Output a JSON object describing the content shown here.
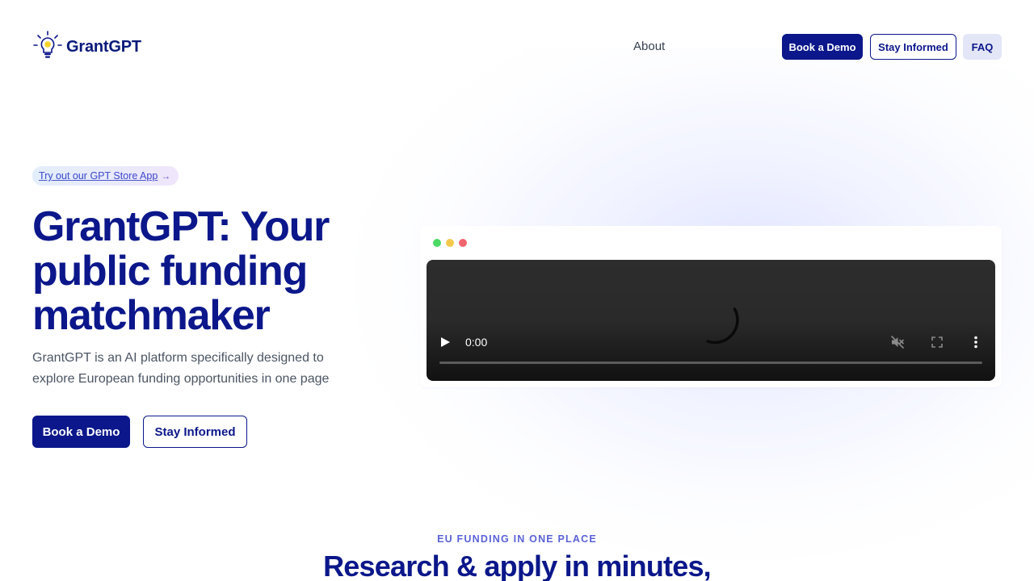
{
  "header": {
    "brand": "GrantGPT",
    "nav": {
      "about": "About"
    },
    "buttons": {
      "book_demo": "Book a Demo",
      "stay_informed": "Stay Informed",
      "faq": "FAQ"
    }
  },
  "hero": {
    "pill": {
      "label": "Try out our GPT Store App",
      "arrow": "→"
    },
    "title": "GrantGPT: Your public funding matchmaker",
    "subtitle": "GrantGPT is an AI platform specifically designed to explore European funding opportunities in one page",
    "buttons": {
      "book_demo": "Book a Demo",
      "stay_informed": "Stay Informed"
    }
  },
  "video": {
    "time": "0:00",
    "state": "loading"
  },
  "section": {
    "eyebrow": "EU FUNDING IN ONE PLACE",
    "title": "Research & apply in minutes,"
  },
  "colors": {
    "brand_navy": "#0b178a",
    "accent_purple": "#5b62d6",
    "dot_green": "#4cd964",
    "dot_yellow": "#f2c94c",
    "dot_red": "#f0646e"
  },
  "icons": {
    "logo": "lightbulb-icon",
    "play": "play-icon",
    "mute": "muted-volume-icon",
    "fullscreen": "fullscreen-icon",
    "more": "more-vertical-icon"
  }
}
